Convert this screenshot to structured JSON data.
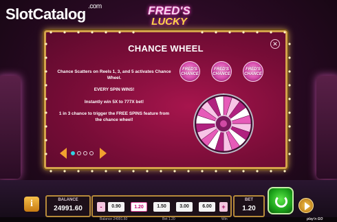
{
  "watermark": {
    "brand": "SlotCatalog",
    "domain": ".com"
  },
  "game": {
    "logo_line1": "FRED'S",
    "logo_line2": "LUCKY"
  },
  "panel": {
    "title": "CHANCE WHEEL",
    "paragraphs": [
      "Chance Scatters on Reels 1, 3, and 5 activates Chance Wheel.",
      "EVERY SPIN WINS!",
      "Instantly win 5X to 777X bet!",
      "1 in 3 chance to trigger the FREE SPINS feature from the chance wheel!"
    ],
    "chance_icon_label_1": "FRED'S",
    "chance_icon_label_2": "CHANCE",
    "close_glyph": "✕"
  },
  "pagination": {
    "pages": 4,
    "active": 1
  },
  "bottom_bar": {
    "info_label": "i",
    "balance_label": "BALANCE",
    "balance_value": "24991.60",
    "bet_minus": "-",
    "bet_plus": "+",
    "bet_options": [
      "0.90",
      "1.20",
      "1.50",
      "3.00",
      "6.00"
    ],
    "bet_selected": "1.20",
    "bet_label": "BET",
    "bet_value": "1.20"
  },
  "footer": {
    "balance_text": "Balance 24991.60",
    "bet_text": "Bet 1.20",
    "win_text": "Win",
    "brand": "play'n GO"
  },
  "colors": {
    "panel_red": "#8f1242",
    "gold_border": "#d4a24a",
    "active_dot": "#31d2e3",
    "spin_green": "#1ca21a"
  }
}
